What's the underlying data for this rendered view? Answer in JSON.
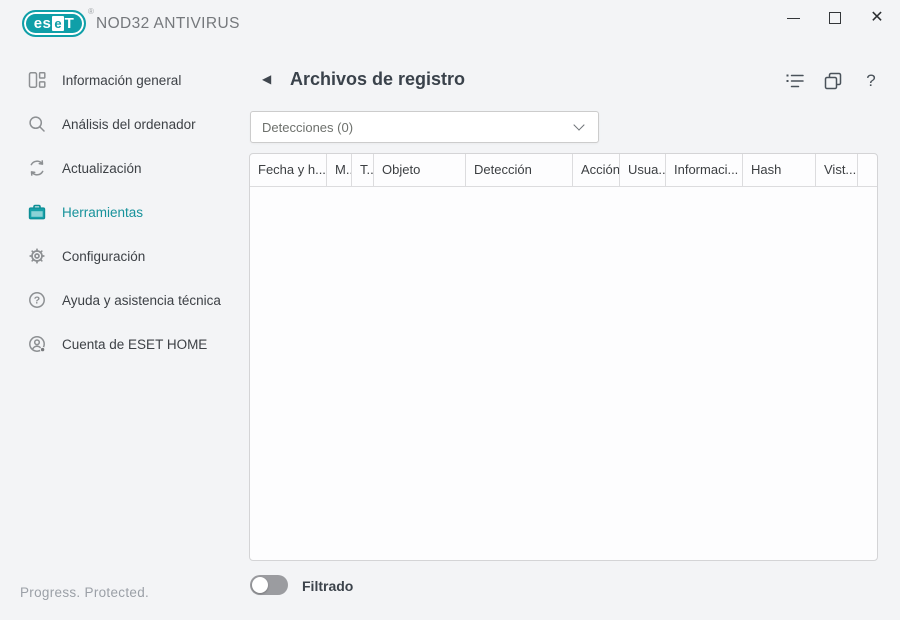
{
  "brand": {
    "logo_left": "es",
    "logo_boxed": "e",
    "logo_right": "T",
    "registered": "®",
    "product": "NOD32 ANTIVIRUS"
  },
  "window_controls": {
    "close": "✕"
  },
  "icons": {
    "question": "?"
  },
  "sidebar": {
    "items": [
      {
        "label": "Información general"
      },
      {
        "label": "Análisis del ordenador"
      },
      {
        "label": "Actualización"
      },
      {
        "label": "Herramientas",
        "active": true
      },
      {
        "label": "Configuración"
      },
      {
        "label": "Ayuda y asistencia técnica"
      },
      {
        "label": "Cuenta de ESET HOME"
      }
    ]
  },
  "main": {
    "back_glyph": "◀",
    "title": "Archivos de registro",
    "dropdown": {
      "value": "Detecciones (0)"
    },
    "table": {
      "columns": [
        "Fecha y h...",
        "M..",
        "T...",
        "Objeto",
        "Detección",
        "Acción",
        "Usua...",
        "Informaci...",
        "Hash",
        "Vist...",
        ""
      ],
      "rows": []
    },
    "toggle": {
      "label": "Filtrado",
      "state": "off"
    }
  },
  "footer": {
    "tagline": "Progress. Protected."
  },
  "colors": {
    "accent": "#0f9fa8",
    "active_item": "#17929b",
    "background": "#f3f4f6",
    "table_border": "#d4d4d6"
  }
}
